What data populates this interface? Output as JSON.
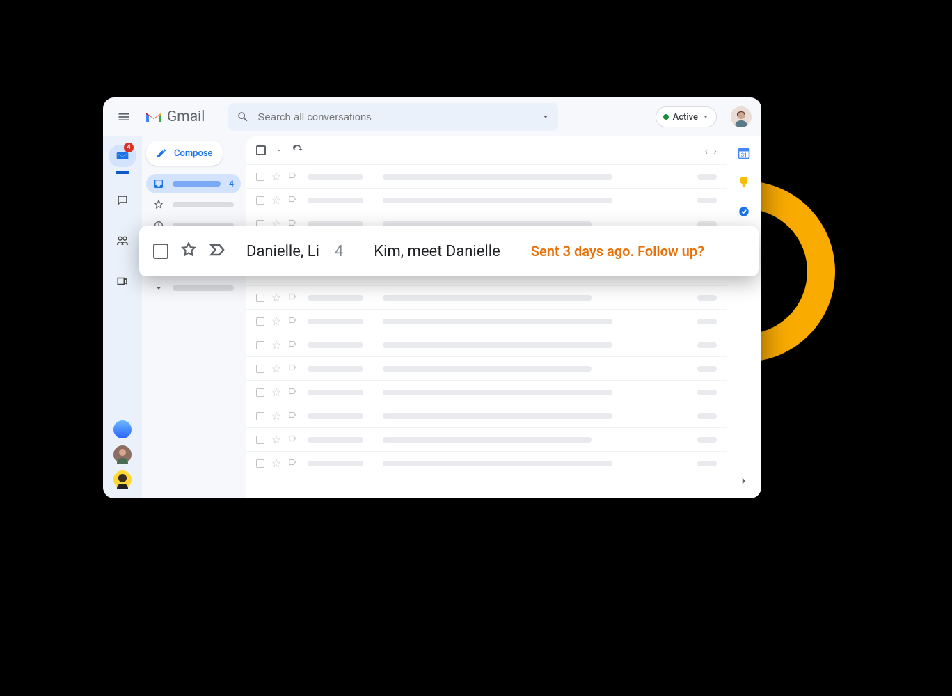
{
  "header": {
    "app_name": "Gmail",
    "search_placeholder": "Search all conversations",
    "status_label": "Active"
  },
  "rail": {
    "mail_badge": "4"
  },
  "sidebar": {
    "compose_label": "Compose",
    "inbox_count": "4"
  },
  "highlighted_email": {
    "sender": "Danielle, Li",
    "thread_count": "4",
    "subject": "Kim, meet Danielle",
    "nudge": "Sent 3 days ago. Follow up?"
  }
}
